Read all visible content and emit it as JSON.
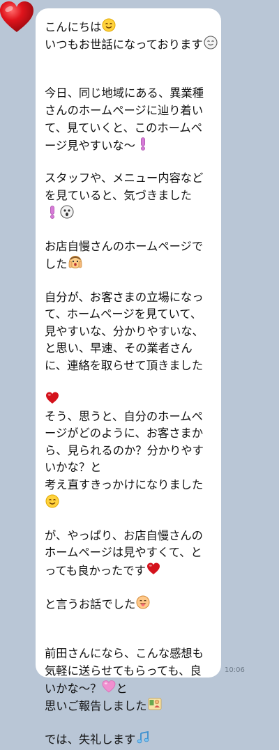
{
  "chat": {
    "timestamp": "10:06",
    "lines": [
      "こんにちは",
      "いつもお世話になっております",
      "",
      "",
      "今日、同じ地域にある、異業種",
      "さんのホームページに辿り着い",
      "て、見ていくと、このホームペ",
      "ージ見やすいな～",
      "",
      "スタッフや、メニュー内容など",
      "を見ていると、気づきました",
      "",
      "",
      "お店自慢さんのホームページで",
      "した",
      "",
      "自分が、お客さまの立場になっ",
      "て、ホームページを見ていて、",
      "見やすいな、分かりやすいな、",
      "と思い、早速、その業者さん",
      "に、連絡を取らせて頂きました",
      "",
      "",
      "そう、思うと、自分のホームペ",
      "ージがどのように、お客さまか",
      "ら、見られるのか？分かりやす",
      "いかな？と",
      "考え直すきっかけになりました",
      "",
      "",
      "が、やっぱり、お店自慢さんの",
      "ホームページは見やすくて、と",
      "っても良かったです",
      "",
      "と言うお話でした",
      "",
      "",
      "前田さんになら、こんな感想も",
      "気軽に送らせてもらっても、良",
      "いかな～？",
      "思いご報告しました",
      "",
      "では、失礼します"
    ],
    "line_emojis": {
      "0": [
        "smile-emoji"
      ],
      "1": [
        "relieved-face-emoji"
      ],
      "7": [
        "pink-exclamation-emoji"
      ],
      "11": [
        "pink-exclamation-emoji",
        "shocked-face-emoji"
      ],
      "14": [
        "hands-on-cheeks-emoji"
      ],
      "22": [
        "red-heart-emoji"
      ],
      "28": [
        "smile-emoji"
      ],
      "32": [
        "red-heart-emoji"
      ],
      "34": [
        "tongue-face-emoji"
      ],
      "39": [
        "pink-heart-emoji"
      ],
      "40": [
        "bowing-figure-emoji"
      ],
      "42": [
        "music-note-emoji"
      ]
    },
    "after_emoji_text": {
      "39": "と"
    }
  },
  "avatar": {
    "icon": "heart-avatar"
  },
  "colors": {
    "background": "#b9c6d6",
    "bubble": "#ffffff",
    "text": "#111111",
    "heart": "#d0131b",
    "pink": "#e07cc0"
  }
}
